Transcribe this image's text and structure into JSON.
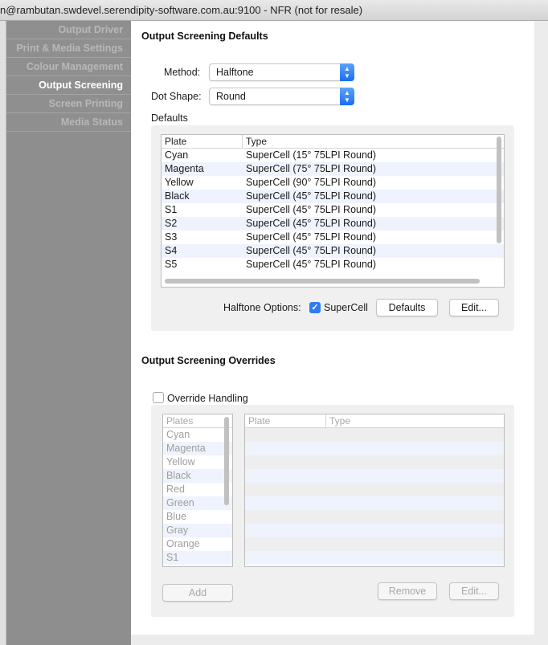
{
  "window": {
    "title": "n@rambutan.swdevel.serendipity-software.com.au:9100 - NFR (not for resale)"
  },
  "sidebar": {
    "items": [
      {
        "label": "Output Driver",
        "active": false
      },
      {
        "label": "Print & Media Settings",
        "active": false
      },
      {
        "label": "Colour Management",
        "active": false
      },
      {
        "label": "Output Screening",
        "active": true
      },
      {
        "label": "Screen Printing",
        "active": false
      },
      {
        "label": "Media Status",
        "active": false
      }
    ]
  },
  "defaults_section": {
    "title": "Output Screening Defaults",
    "method_label": "Method:",
    "method_value": "Halftone",
    "dot_shape_label": "Dot Shape:",
    "dot_shape_value": "Round",
    "defaults_label": "Defaults",
    "columns": [
      "Plate",
      "Type"
    ],
    "rows": [
      [
        "Cyan",
        "SuperCell (15° 75LPI Round)"
      ],
      [
        "Magenta",
        "SuperCell (75° 75LPI Round)"
      ],
      [
        "Yellow",
        "SuperCell (90° 75LPI Round)"
      ],
      [
        "Black",
        "SuperCell (45° 75LPI Round)"
      ],
      [
        "S1",
        "SuperCell (45° 75LPI Round)"
      ],
      [
        "S2",
        "SuperCell (45° 75LPI Round)"
      ],
      [
        "S3",
        "SuperCell (45° 75LPI Round)"
      ],
      [
        "S4",
        "SuperCell (45° 75LPI Round)"
      ],
      [
        "S5",
        "SuperCell (45° 75LPI Round)"
      ]
    ],
    "halftone_options_label": "Halftone Options:",
    "supercell_label": "SuperCell",
    "supercell_checked": true,
    "defaults_button": "Defaults",
    "edit_button": "Edit..."
  },
  "overrides_section": {
    "title": "Output Screening Overrides",
    "override_handling_label": "Override Handling",
    "override_handling_checked": false,
    "plates_header": "Plates",
    "plates": [
      "Cyan",
      "Magenta",
      "Yellow",
      "Black",
      "Red",
      "Green",
      "Blue",
      "Gray",
      "Orange",
      "S1"
    ],
    "columns": [
      "Plate",
      "Type"
    ],
    "add_button": "Add",
    "remove_button": "Remove",
    "edit_button": "Edit..."
  },
  "colors": {
    "accent": "#2f7bf5",
    "sidebar_bg": "#8e8e8e",
    "row_alt": "#eef3fd"
  }
}
